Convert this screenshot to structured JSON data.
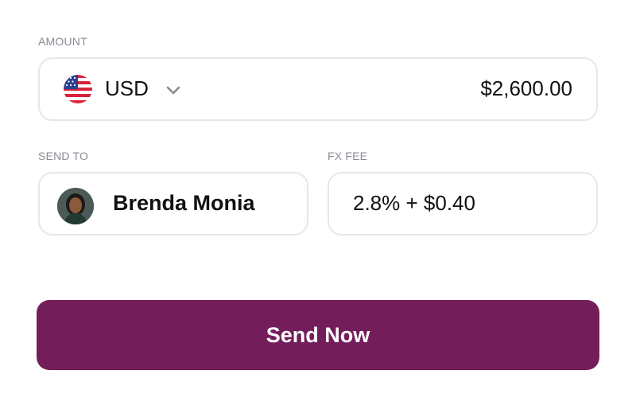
{
  "amount": {
    "label": "AMOUNT",
    "currency_code": "USD",
    "currency_flag_icon": "us-flag-icon",
    "dropdown_icon": "chevron-down-icon",
    "value": "$2,600.00"
  },
  "send_to": {
    "label": "SEND TO",
    "recipient_name": "Brenda Monia",
    "avatar_icon": "avatar"
  },
  "fx_fee": {
    "label": "FX FEE",
    "value": "2.8% + $0.40"
  },
  "actions": {
    "send_label": "Send Now"
  },
  "colors": {
    "primary": "#731e5b",
    "field_border": "#e6e6ee",
    "label_text": "#8a8a96"
  }
}
